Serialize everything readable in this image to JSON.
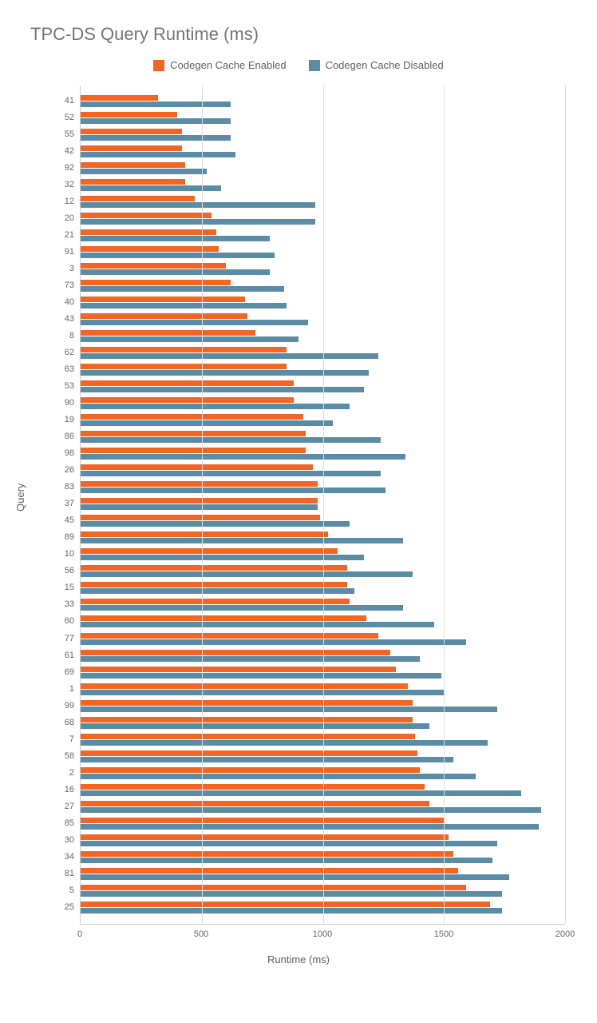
{
  "title": "TPC-DS Query Runtime (ms)",
  "legend": {
    "enabled": "Codegen Cache Enabled",
    "disabled": "Codegen Cache Disabled"
  },
  "xlabel": "Runtime (ms)",
  "ylabel": "Query",
  "chart_data": {
    "type": "bar",
    "orientation": "horizontal",
    "xlim": [
      0,
      2000
    ],
    "xticks": [
      0,
      500,
      1000,
      1500,
      2000
    ],
    "xlabel": "Runtime (ms)",
    "ylabel": "Query",
    "title": "TPC-DS Query Runtime (ms)",
    "series_names": [
      "Codegen Cache Enabled",
      "Codegen Cache Disabled"
    ],
    "categories": [
      "41",
      "52",
      "55",
      "42",
      "92",
      "32",
      "12",
      "20",
      "21",
      "91",
      "3",
      "73",
      "40",
      "43",
      "8",
      "62",
      "63",
      "53",
      "90",
      "19",
      "86",
      "98",
      "26",
      "83",
      "37",
      "45",
      "89",
      "10",
      "56",
      "15",
      "33",
      "60",
      "77",
      "61",
      "69",
      "1",
      "99",
      "68",
      "7",
      "58",
      "2",
      "16",
      "27",
      "85",
      "30",
      "34",
      "81",
      "5",
      "25"
    ],
    "series": [
      {
        "name": "Codegen Cache Enabled",
        "color": "#f26522",
        "values": [
          320,
          400,
          420,
          420,
          430,
          430,
          470,
          540,
          560,
          570,
          600,
          620,
          680,
          690,
          720,
          850,
          850,
          880,
          880,
          920,
          930,
          930,
          960,
          980,
          980,
          990,
          1020,
          1060,
          1100,
          1100,
          1110,
          1180,
          1230,
          1280,
          1300,
          1350,
          1370,
          1370,
          1380,
          1390,
          1400,
          1420,
          1440,
          1500,
          1520,
          1540,
          1560,
          1590,
          1690
        ],
        "key": "enabled"
      },
      {
        "name": "Codegen Cache Disabled",
        "color": "#5b8ca5",
        "values": [
          620,
          620,
          620,
          640,
          520,
          580,
          970,
          970,
          780,
          800,
          780,
          840,
          850,
          940,
          900,
          1230,
          1190,
          1170,
          1110,
          1040,
          1240,
          1340,
          1240,
          1260,
          980,
          1110,
          1330,
          1170,
          1370,
          1130,
          1330,
          1460,
          1590,
          1400,
          1490,
          1500,
          1720,
          1440,
          1680,
          1540,
          1630,
          1820,
          1900,
          1890,
          1720,
          1700,
          1770,
          1740,
          1740
        ],
        "key": "disabled"
      }
    ]
  }
}
